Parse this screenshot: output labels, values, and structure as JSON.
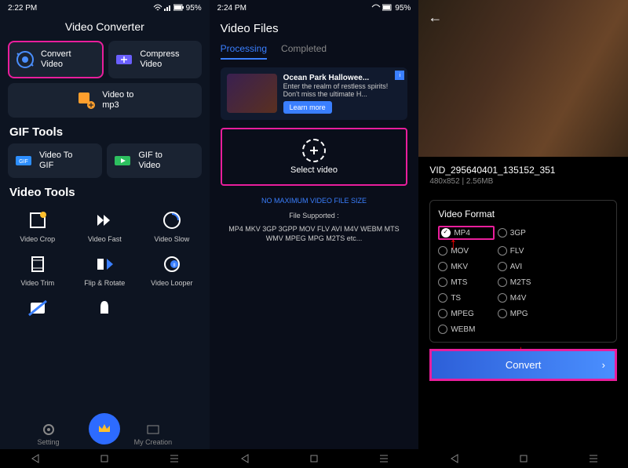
{
  "status": {
    "time1": "2:22 PM",
    "time2": "2:24 PM",
    "battery": "95%"
  },
  "phone1": {
    "title": "Video Converter",
    "tools": {
      "convert": "Convert\nVideo",
      "compress": "Compress\nVideo",
      "tomp3": "Video to\nmp3"
    },
    "gif_title": "GIF Tools",
    "gif": {
      "togif": "Video To\nGIF",
      "tovideo": "GIF to\nVideo"
    },
    "video_title": "Video Tools",
    "vt": [
      "Video Crop",
      "Video Fast",
      "Video Slow",
      "Video Trim",
      "Flip & Rotate",
      "Video Looper"
    ],
    "nav": {
      "setting": "Setting",
      "creation": "My Creation"
    }
  },
  "phone2": {
    "title": "Video Files",
    "tabs": {
      "t1": "Processing",
      "t2": "Completed"
    },
    "ad": {
      "title": "Ocean Park Hallowee...",
      "text": "Enter the realm of restless spirits! Don't miss the ultimate H...",
      "btn": "Learn more"
    },
    "select": "Select video",
    "nomax": "NO MAXIMUM VIDEO FILE SIZE",
    "support_label": "File Supported :",
    "support": "MP4 MKV 3GP 3GPP MOV FLV AVI M4V WEBM MTS WMV MPEG MPG M2TS etc..."
  },
  "phone3": {
    "vidname": "VID_295640401_135152_351",
    "vidmeta": "480x852  |  2.56MB",
    "format_title": "Video Format",
    "formats": [
      "MP4",
      "3GP",
      "MOV",
      "FLV",
      "MKV",
      "AVI",
      "MTS",
      "M2TS",
      "TS",
      "M4V",
      "MPEG",
      "MPG",
      "WEBM"
    ],
    "convert": "Convert"
  }
}
